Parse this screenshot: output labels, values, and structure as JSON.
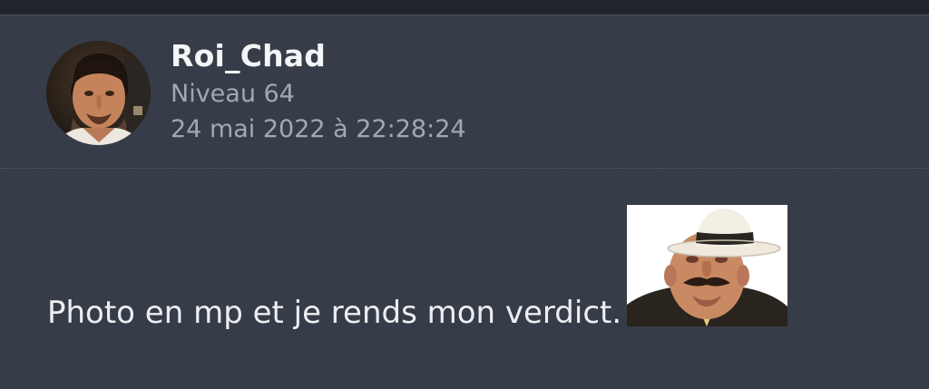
{
  "post": {
    "author": {
      "username": "Roi_Chad",
      "level": "Niveau 64",
      "avatar_icon": "user-avatar"
    },
    "timestamp": "24 mai 2022 à 22:28:24",
    "message": "Photo en mp et je rends mon verdict.",
    "sticker_icon": "risitas-sticker"
  }
}
